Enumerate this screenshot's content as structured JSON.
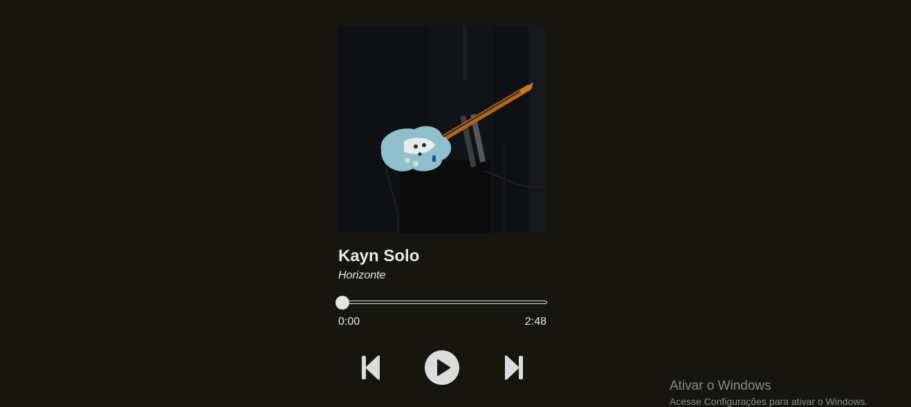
{
  "track": {
    "title": "Kayn Solo",
    "artist": "Horizonte",
    "cover_description_icon": "guitar-photo",
    "current_time": "0:00",
    "duration": "2:48",
    "progress_fraction": 0.0
  },
  "controls": {
    "previous_icon": "skip-previous-icon",
    "play_icon": "play-icon",
    "next_icon": "skip-next-icon"
  },
  "watermark": {
    "title": "Ativar o Windows",
    "subtitle": "Acesse Configurações para ativar o Windows."
  },
  "colors": {
    "background": "#161510",
    "foreground": "#e9e9e9",
    "watermark": "#8c8c88"
  }
}
